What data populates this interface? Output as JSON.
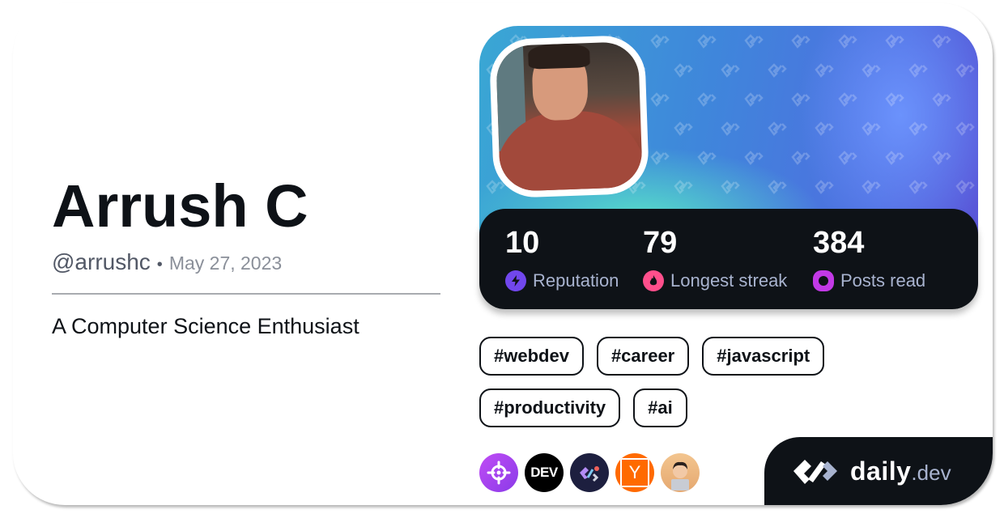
{
  "profile": {
    "name": "Arrush C",
    "handle": "@arrushc",
    "separator": "•",
    "joined_date": "May 27, 2023",
    "bio": "A Computer Science Enthusiast"
  },
  "stats": [
    {
      "value": "10",
      "label": "Reputation",
      "icon": "reputation-bolt-icon",
      "color": "#7147ed"
    },
    {
      "value": "79",
      "label": "Longest streak",
      "icon": "streak-flame-icon",
      "color": "#ff4f8c"
    },
    {
      "value": "384",
      "label": "Posts read",
      "icon": "posts-read-ring-icon",
      "color": "#c239e6"
    }
  ],
  "tags": [
    "#webdev",
    "#career",
    "#javascript",
    "#productivity",
    "#ai"
  ],
  "sources": [
    {
      "name": "crosshair-source-icon",
      "label": "",
      "color": "#a93ff0"
    },
    {
      "name": "dev-to-source-icon",
      "label": "DEV",
      "color": "#000000"
    },
    {
      "name": "daily-dev-squad-source-icon",
      "label": "",
      "color": "#1d1f3f"
    },
    {
      "name": "hacker-news-source-icon",
      "label": "Y",
      "color": "#ff6a00"
    },
    {
      "name": "devsquad-avatar-source-icon",
      "label": "",
      "color": "#e7b07a"
    }
  ],
  "brand": {
    "primary": "daily",
    "secondary": ".dev"
  }
}
